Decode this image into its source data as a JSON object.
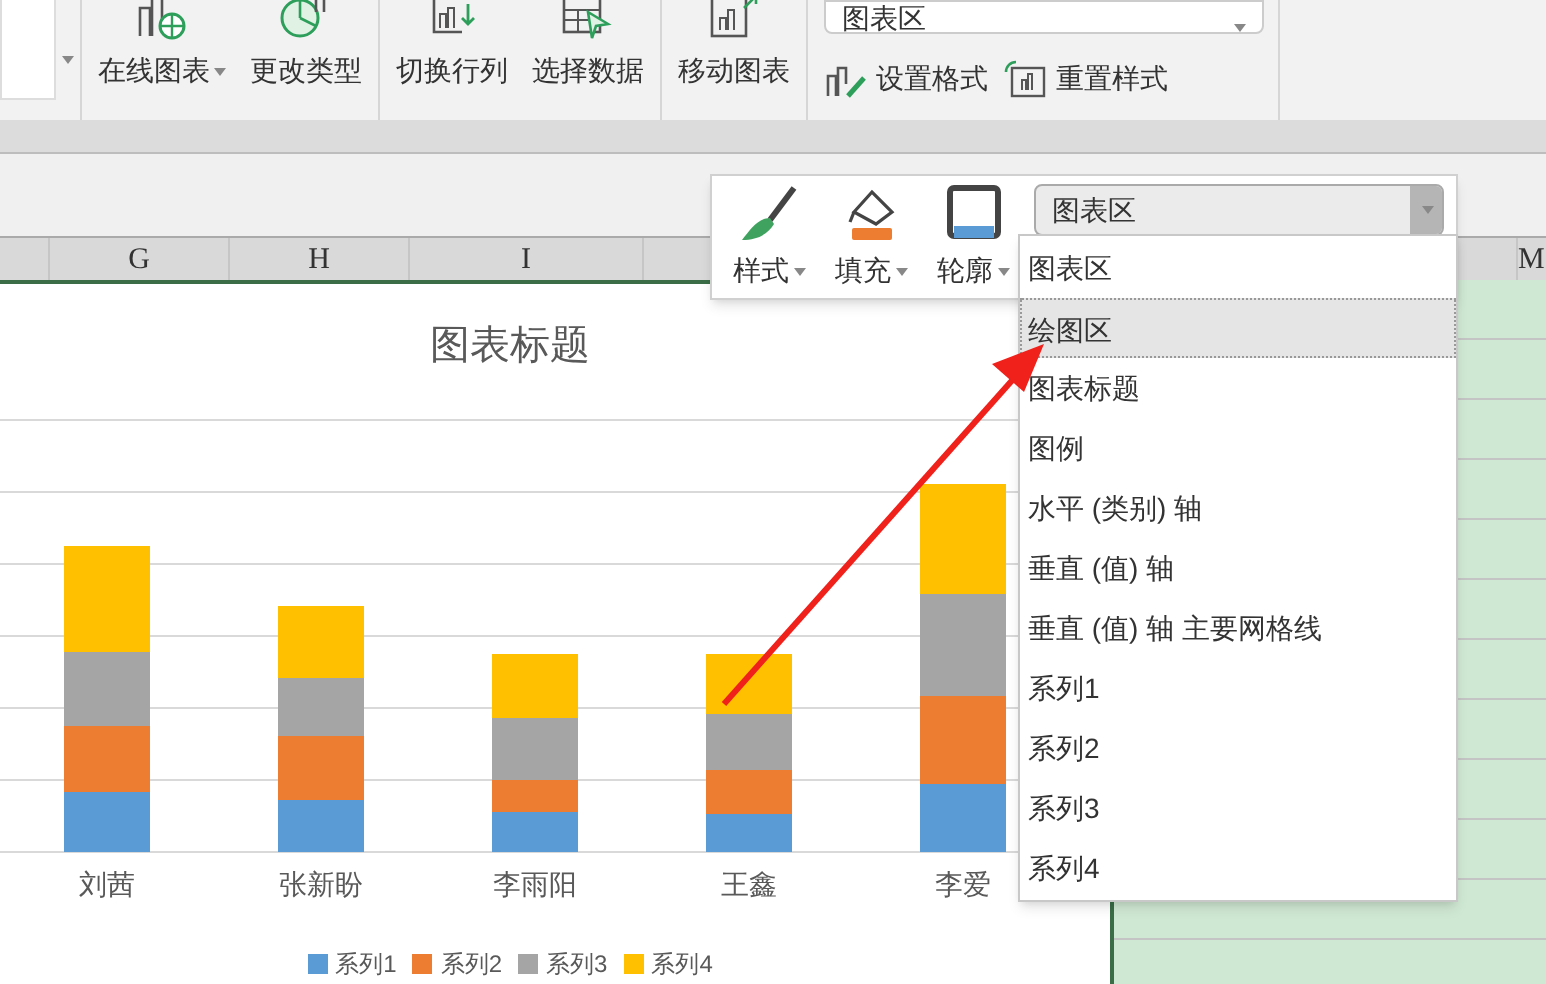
{
  "ribbon": {
    "groups": [
      {
        "buttons": [
          {
            "label": "在线图表",
            "has_menu": true
          },
          {
            "label": "更改类型",
            "has_menu": false
          }
        ]
      },
      {
        "buttons": [
          {
            "label": "切换行列",
            "has_menu": false
          },
          {
            "label": "选择数据",
            "has_menu": false
          }
        ]
      },
      {
        "buttons": [
          {
            "label": "移动图表",
            "has_menu": false
          }
        ]
      }
    ],
    "element_select": {
      "value": "图表区"
    },
    "format_buttons": [
      {
        "label": "设置格式"
      },
      {
        "label": "重置样式"
      }
    ]
  },
  "column_headers": [
    {
      "label": "G"
    },
    {
      "label": "H"
    },
    {
      "label": "I"
    },
    {
      "label": "M"
    }
  ],
  "mini_toolbar": {
    "buttons": [
      {
        "label": "样式"
      },
      {
        "label": "填充"
      },
      {
        "label": "轮廓"
      }
    ],
    "select": {
      "value": "图表区"
    },
    "options": [
      {
        "label": "图表区",
        "selected": false
      },
      {
        "label": "绘图区",
        "selected": true
      },
      {
        "label": "图表标题",
        "selected": false
      },
      {
        "label": "图例",
        "selected": false
      },
      {
        "label": "水平 (类别) 轴",
        "selected": false
      },
      {
        "label": "垂直 (值) 轴",
        "selected": false
      },
      {
        "label": "垂直 (值) 轴 主要网格线",
        "selected": false
      },
      {
        "label": "系列1",
        "selected": false
      },
      {
        "label": "系列2",
        "selected": false
      },
      {
        "label": "系列3",
        "selected": false
      },
      {
        "label": "系列4",
        "selected": false
      }
    ]
  },
  "chart": {
    "title": "图表标题",
    "categories": [
      "刘茜",
      "张新盼",
      "李雨阳",
      "王鑫",
      "李爱"
    ],
    "legend": [
      {
        "label": "系列1",
        "color": "#5b9bd5"
      },
      {
        "label": "系列2",
        "color": "#ed7d31"
      },
      {
        "label": "系列3",
        "color": "#a5a5a5"
      },
      {
        "label": "系列4",
        "color": "#ffc000"
      }
    ]
  }
}
